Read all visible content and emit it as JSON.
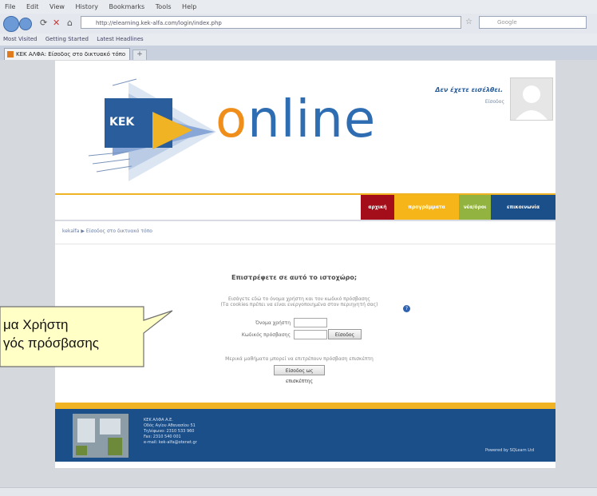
{
  "browser": {
    "menu": [
      "File",
      "Edit",
      "View",
      "History",
      "Bookmarks",
      "Tools",
      "Help"
    ],
    "url": "http://elearning.kek-alfa.com/login/index.php",
    "search_placeholder": "Google",
    "bookmarks": [
      "Most Visited",
      "Getting Started",
      "Latest Headlines"
    ],
    "tab_title": "ΚΕΚ ΑΛΦΑ: Είσοδος στο δικτυακό τόπο",
    "new_tab": "+"
  },
  "header": {
    "logo_text": "KEK",
    "brand_parts": [
      "o",
      "nline"
    ],
    "not_logged_in": "Δεν έχετε εισέλθει.",
    "login_link": "Είσοδος"
  },
  "nav": {
    "home": "αρχική",
    "programs": "προγράμματα",
    "news": "νέα/όροι",
    "contact": "επικοινωνία"
  },
  "breadcrumb": "kekalfa ▶ Είσοδος στο δικτυακό τόπο",
  "login": {
    "title": "Επιστρέφετε σε αυτό το ιστοχώρο;",
    "note_line1": "Εισάγετε εδώ το όνομα χρήστη και τον κωδικό πρόσβασης",
    "note_line2": "(Τα cookies πρέπει να είναι ενεργοποιημένα στον περιηγητή σας)",
    "help_glyph": "?",
    "username_label": "Όνομα χρήστη",
    "password_label": "Κωδικός πρόσβασης",
    "login_button": "Είσοδος",
    "guest_note": "Μερικά μαθήματα μπορεί να επιτρέπουν πρόσβαση επισκέπτη",
    "guest_button": "Είσοδος ως επισκέπτης"
  },
  "footer": {
    "info": [
      "ΚΕΚ ΑΛΦΑ Α.Ε.",
      "Οδός Αγίου Αθανασίου 51",
      "Τηλέφωνο: 2310 533 960",
      "Fax: 2310 540 001",
      "e-mail: kek-alfa@otenet.gr"
    ],
    "powered": "Powered by SQLearn Ltd"
  },
  "callout": {
    "line1": "μα Χρήστη",
    "line2": "γός πρόσβασης",
    "fill": "#ffffc6",
    "border": "#707070"
  }
}
